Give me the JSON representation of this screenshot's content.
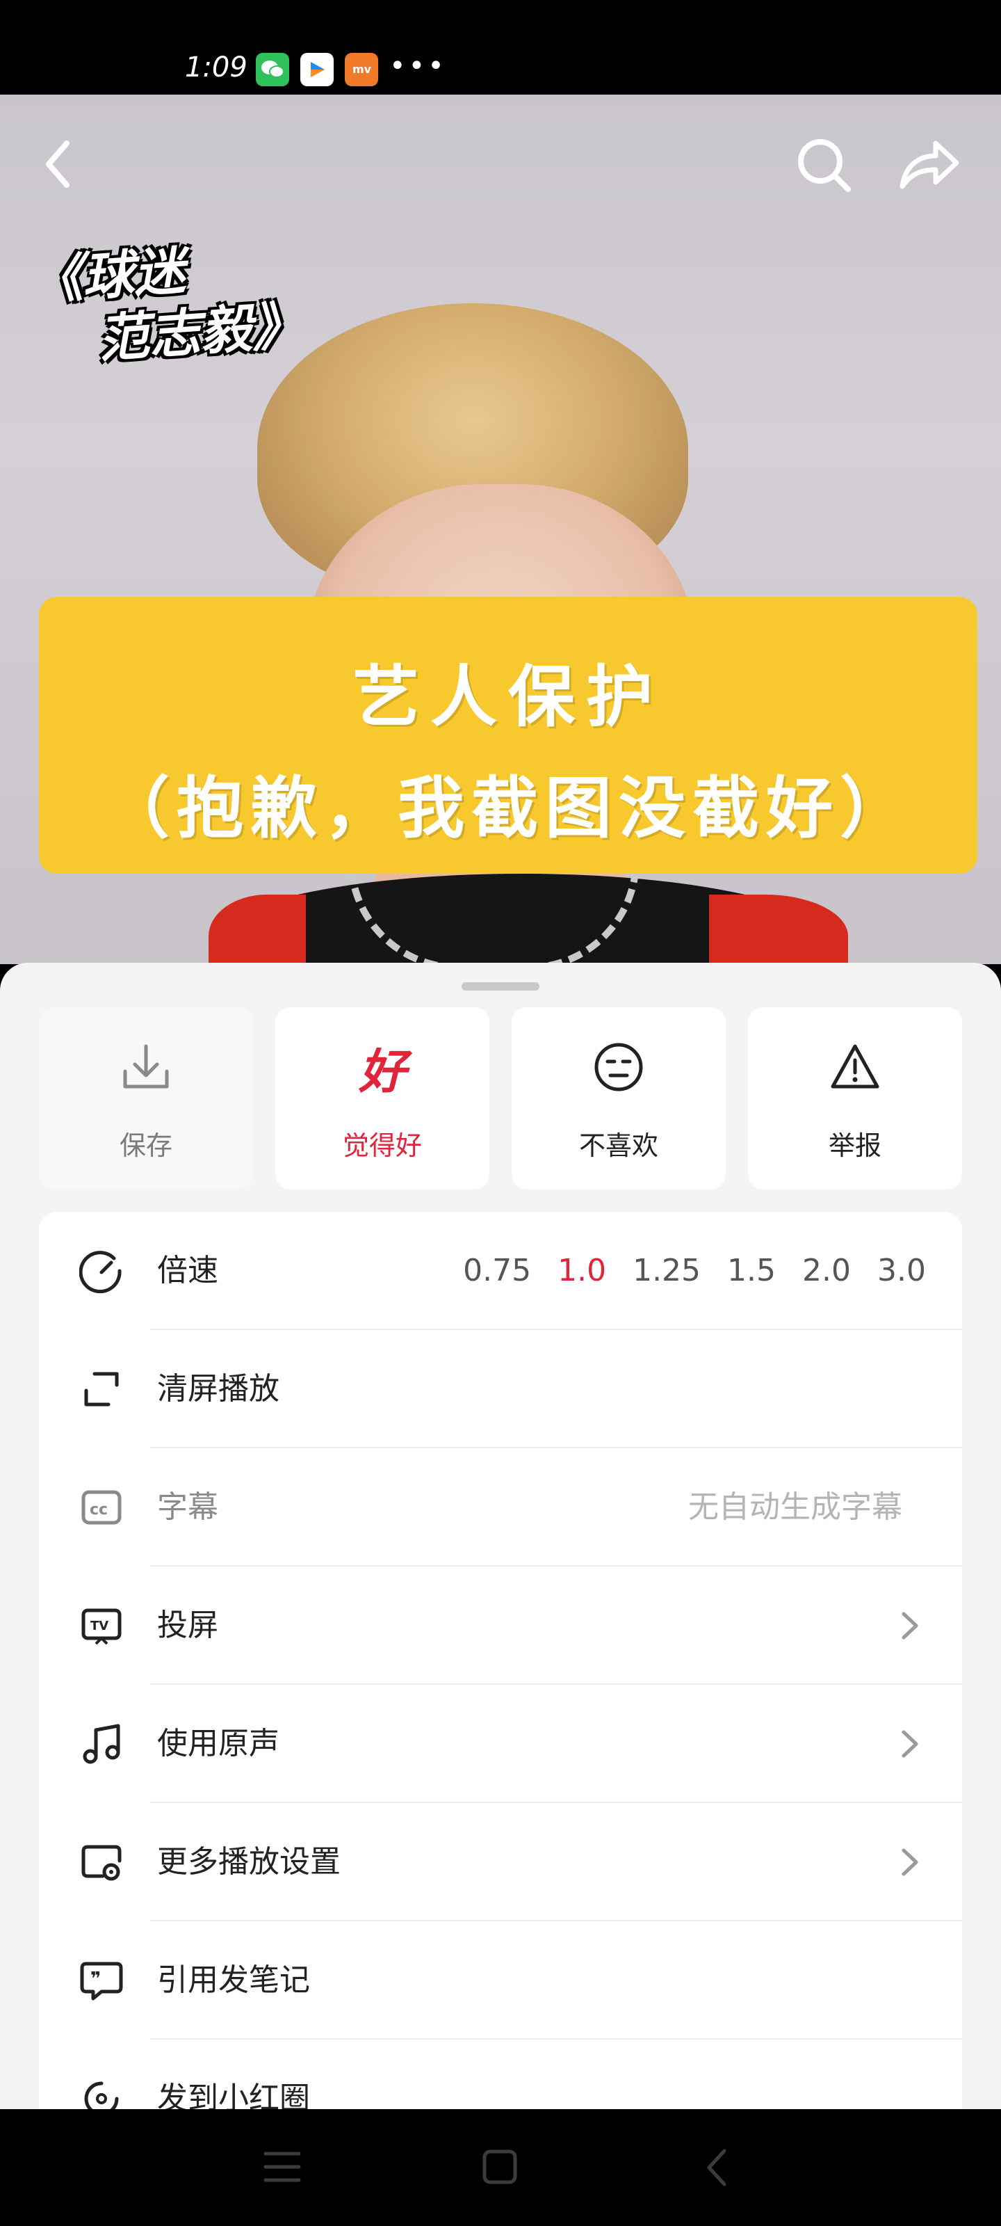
{
  "status": {
    "time": "1:09",
    "apps": [
      "wechat-icon",
      "video-app-icon",
      "mv-app-icon"
    ],
    "more": "•••"
  },
  "video": {
    "logo_line1": "《球迷",
    "logo_line2": "范志毅》",
    "banner_line1": "艺人保护",
    "banner_line2": "（抱歉，我截图没截好）"
  },
  "actions": [
    {
      "label": "保存",
      "icon": "download-icon"
    },
    {
      "label": "觉得好",
      "icon": "good-icon",
      "glyph": "好"
    },
    {
      "label": "不喜欢",
      "icon": "meh-face-icon"
    },
    {
      "label": "举报",
      "icon": "warning-icon"
    }
  ],
  "speed": {
    "label": "倍速",
    "options": [
      "0.75",
      "1.0",
      "1.25",
      "1.5",
      "2.0",
      "3.0"
    ],
    "selected": "1.0"
  },
  "menu": [
    {
      "label": "清屏播放",
      "icon": "fullscreen-icon"
    },
    {
      "label": "字幕",
      "icon": "cc-icon",
      "right_text": "无自动生成字幕"
    },
    {
      "label": "投屏",
      "icon": "tv-cast-icon"
    },
    {
      "label": "使用原声",
      "icon": "music-note-icon"
    },
    {
      "label": "更多播放设置",
      "icon": "settings-screen-icon"
    },
    {
      "label": "引用发笔记",
      "icon": "quote-bubble-icon"
    },
    {
      "label": "发到小红圈",
      "icon": "circle-icon"
    }
  ],
  "colors": {
    "accent": "#e0243a",
    "banner": "#f8c92e",
    "sheet_bg": "#f4f4f4"
  }
}
